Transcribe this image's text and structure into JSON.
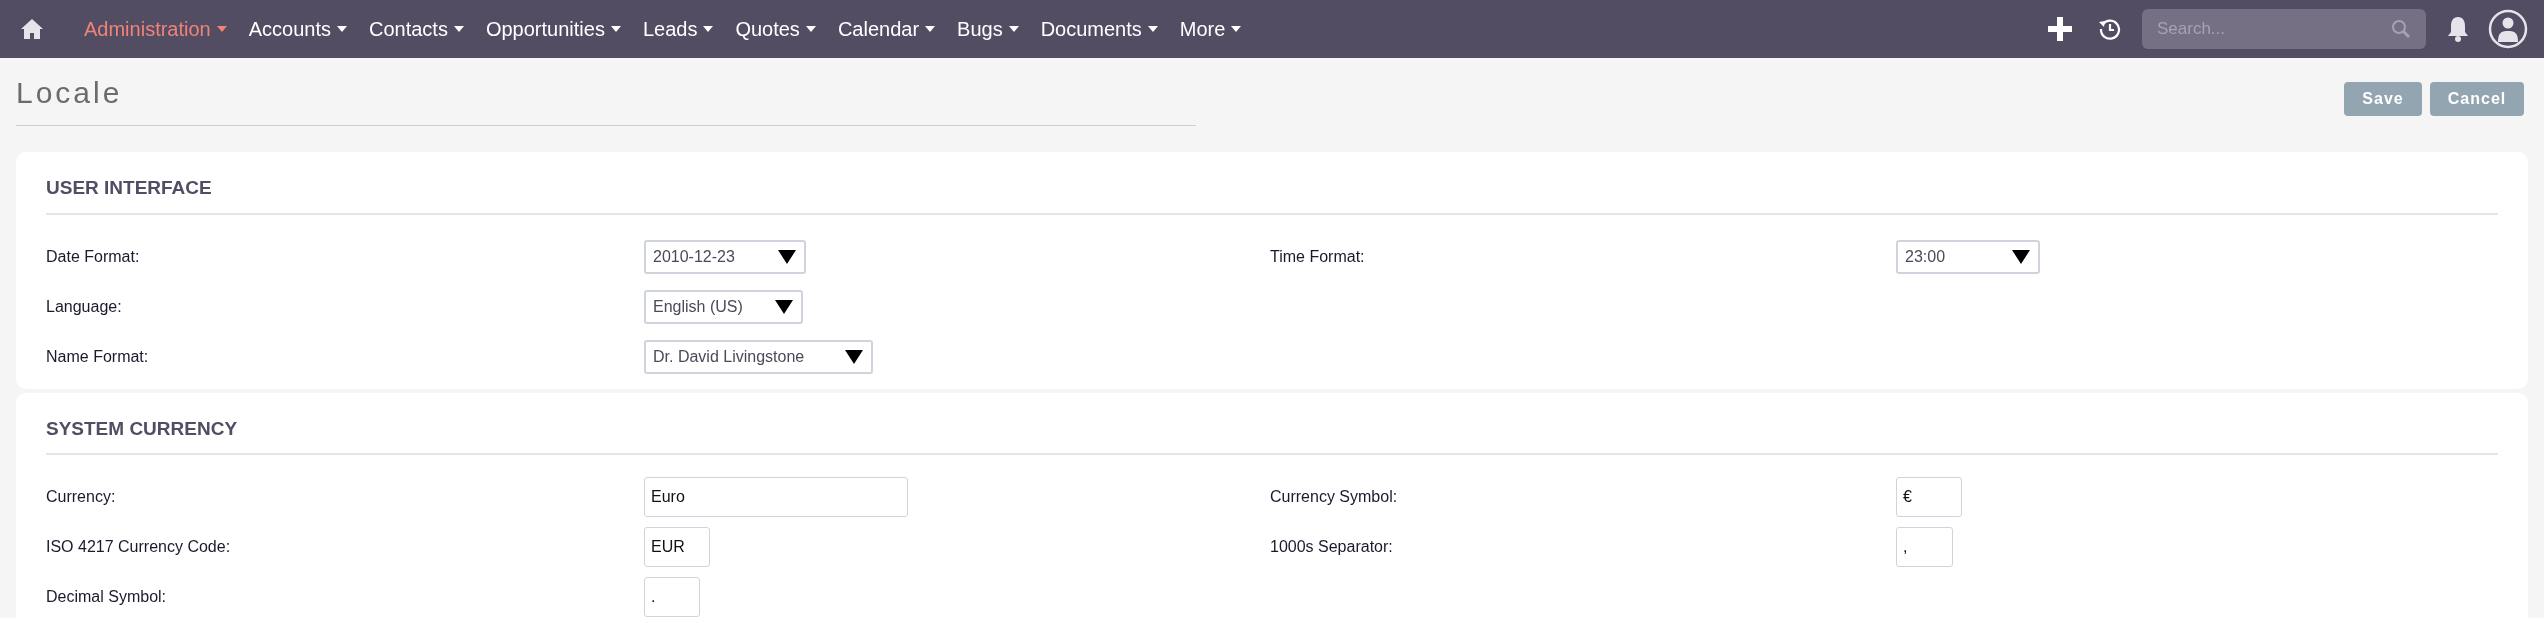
{
  "nav": {
    "items": [
      {
        "label": "Administration",
        "selected": true
      },
      {
        "label": "Accounts",
        "selected": false
      },
      {
        "label": "Contacts",
        "selected": false
      },
      {
        "label": "Opportunities",
        "selected": false
      },
      {
        "label": "Leads",
        "selected": false
      },
      {
        "label": "Quotes",
        "selected": false
      },
      {
        "label": "Calendar",
        "selected": false
      },
      {
        "label": "Bugs",
        "selected": false
      },
      {
        "label": "Documents",
        "selected": false
      },
      {
        "label": "More",
        "selected": false
      }
    ],
    "search": {
      "placeholder": "Search..."
    }
  },
  "page": {
    "title": "Locale",
    "buttons": [
      "Save",
      "Cancel"
    ]
  },
  "sections": [
    {
      "title": "USER INTERFACE",
      "rows": [
        {
          "label": "Date Format:",
          "kind": "select",
          "value": "2010-12-23"
        },
        {
          "label": "Time Format:",
          "kind": "select",
          "value": "23:00"
        },
        {
          "label": "Language:",
          "kind": "select",
          "value": "English (US)"
        },
        {
          "label": "Name Format:",
          "kind": "select",
          "value": "Dr. David Livingstone"
        }
      ]
    },
    {
      "title": "SYSTEM CURRENCY",
      "rows": [
        {
          "label": "Currency:",
          "kind": "text",
          "value": "Euro"
        },
        {
          "label": "Currency Symbol:",
          "kind": "text",
          "value": "€"
        },
        {
          "label": "ISO 4217 Currency Code:",
          "kind": "text",
          "value": "EUR"
        },
        {
          "label": "1000s Separator:",
          "kind": "text",
          "value": ","
        },
        {
          "label": "Decimal Symbol:",
          "kind": "text",
          "value": "."
        }
      ]
    }
  ]
}
